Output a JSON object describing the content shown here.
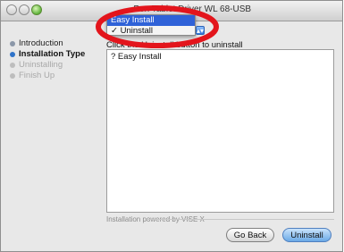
{
  "window": {
    "title": "Install Tablet Driver (WL68-USB)",
    "title_visible": "...Pen Tablet Driver WL 68-USB"
  },
  "sidebar": {
    "steps": [
      {
        "label": "Introduction",
        "state": "done"
      },
      {
        "label": "Installation Type",
        "state": "current"
      },
      {
        "label": "Uninstalling",
        "state": "pending"
      },
      {
        "label": "Finish Up",
        "state": "pending"
      }
    ]
  },
  "popup": {
    "options": [
      "Easy Install",
      "✓ Uninstall"
    ],
    "highlighted": "Easy Install",
    "selected": "Uninstall"
  },
  "content": {
    "instruction": "Click the Uninstall button to uninstall",
    "lines": [
      "? Easy Install"
    ]
  },
  "footer": {
    "powered": "Installation powered by VISE X"
  },
  "buttons": {
    "back": "Go Back",
    "uninstall": "Uninstall"
  },
  "annotation": {
    "color": "#e3151c"
  }
}
